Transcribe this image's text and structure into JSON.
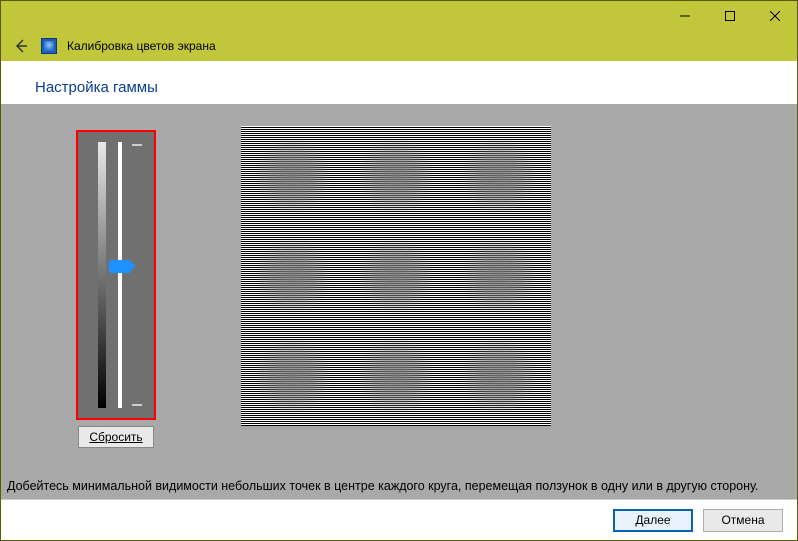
{
  "window": {
    "app_title": "Калибровка цветов экрана"
  },
  "heading": "Настройка гаммы",
  "slider": {
    "value": 50,
    "min": 0,
    "max": 100
  },
  "buttons": {
    "reset": "Сбросить",
    "next": "Далее",
    "cancel": "Отмена"
  },
  "instruction": "Добейтесь минимальной видимости небольших точек в центре каждого круга, перемещая ползунок в одну или в другую сторону."
}
